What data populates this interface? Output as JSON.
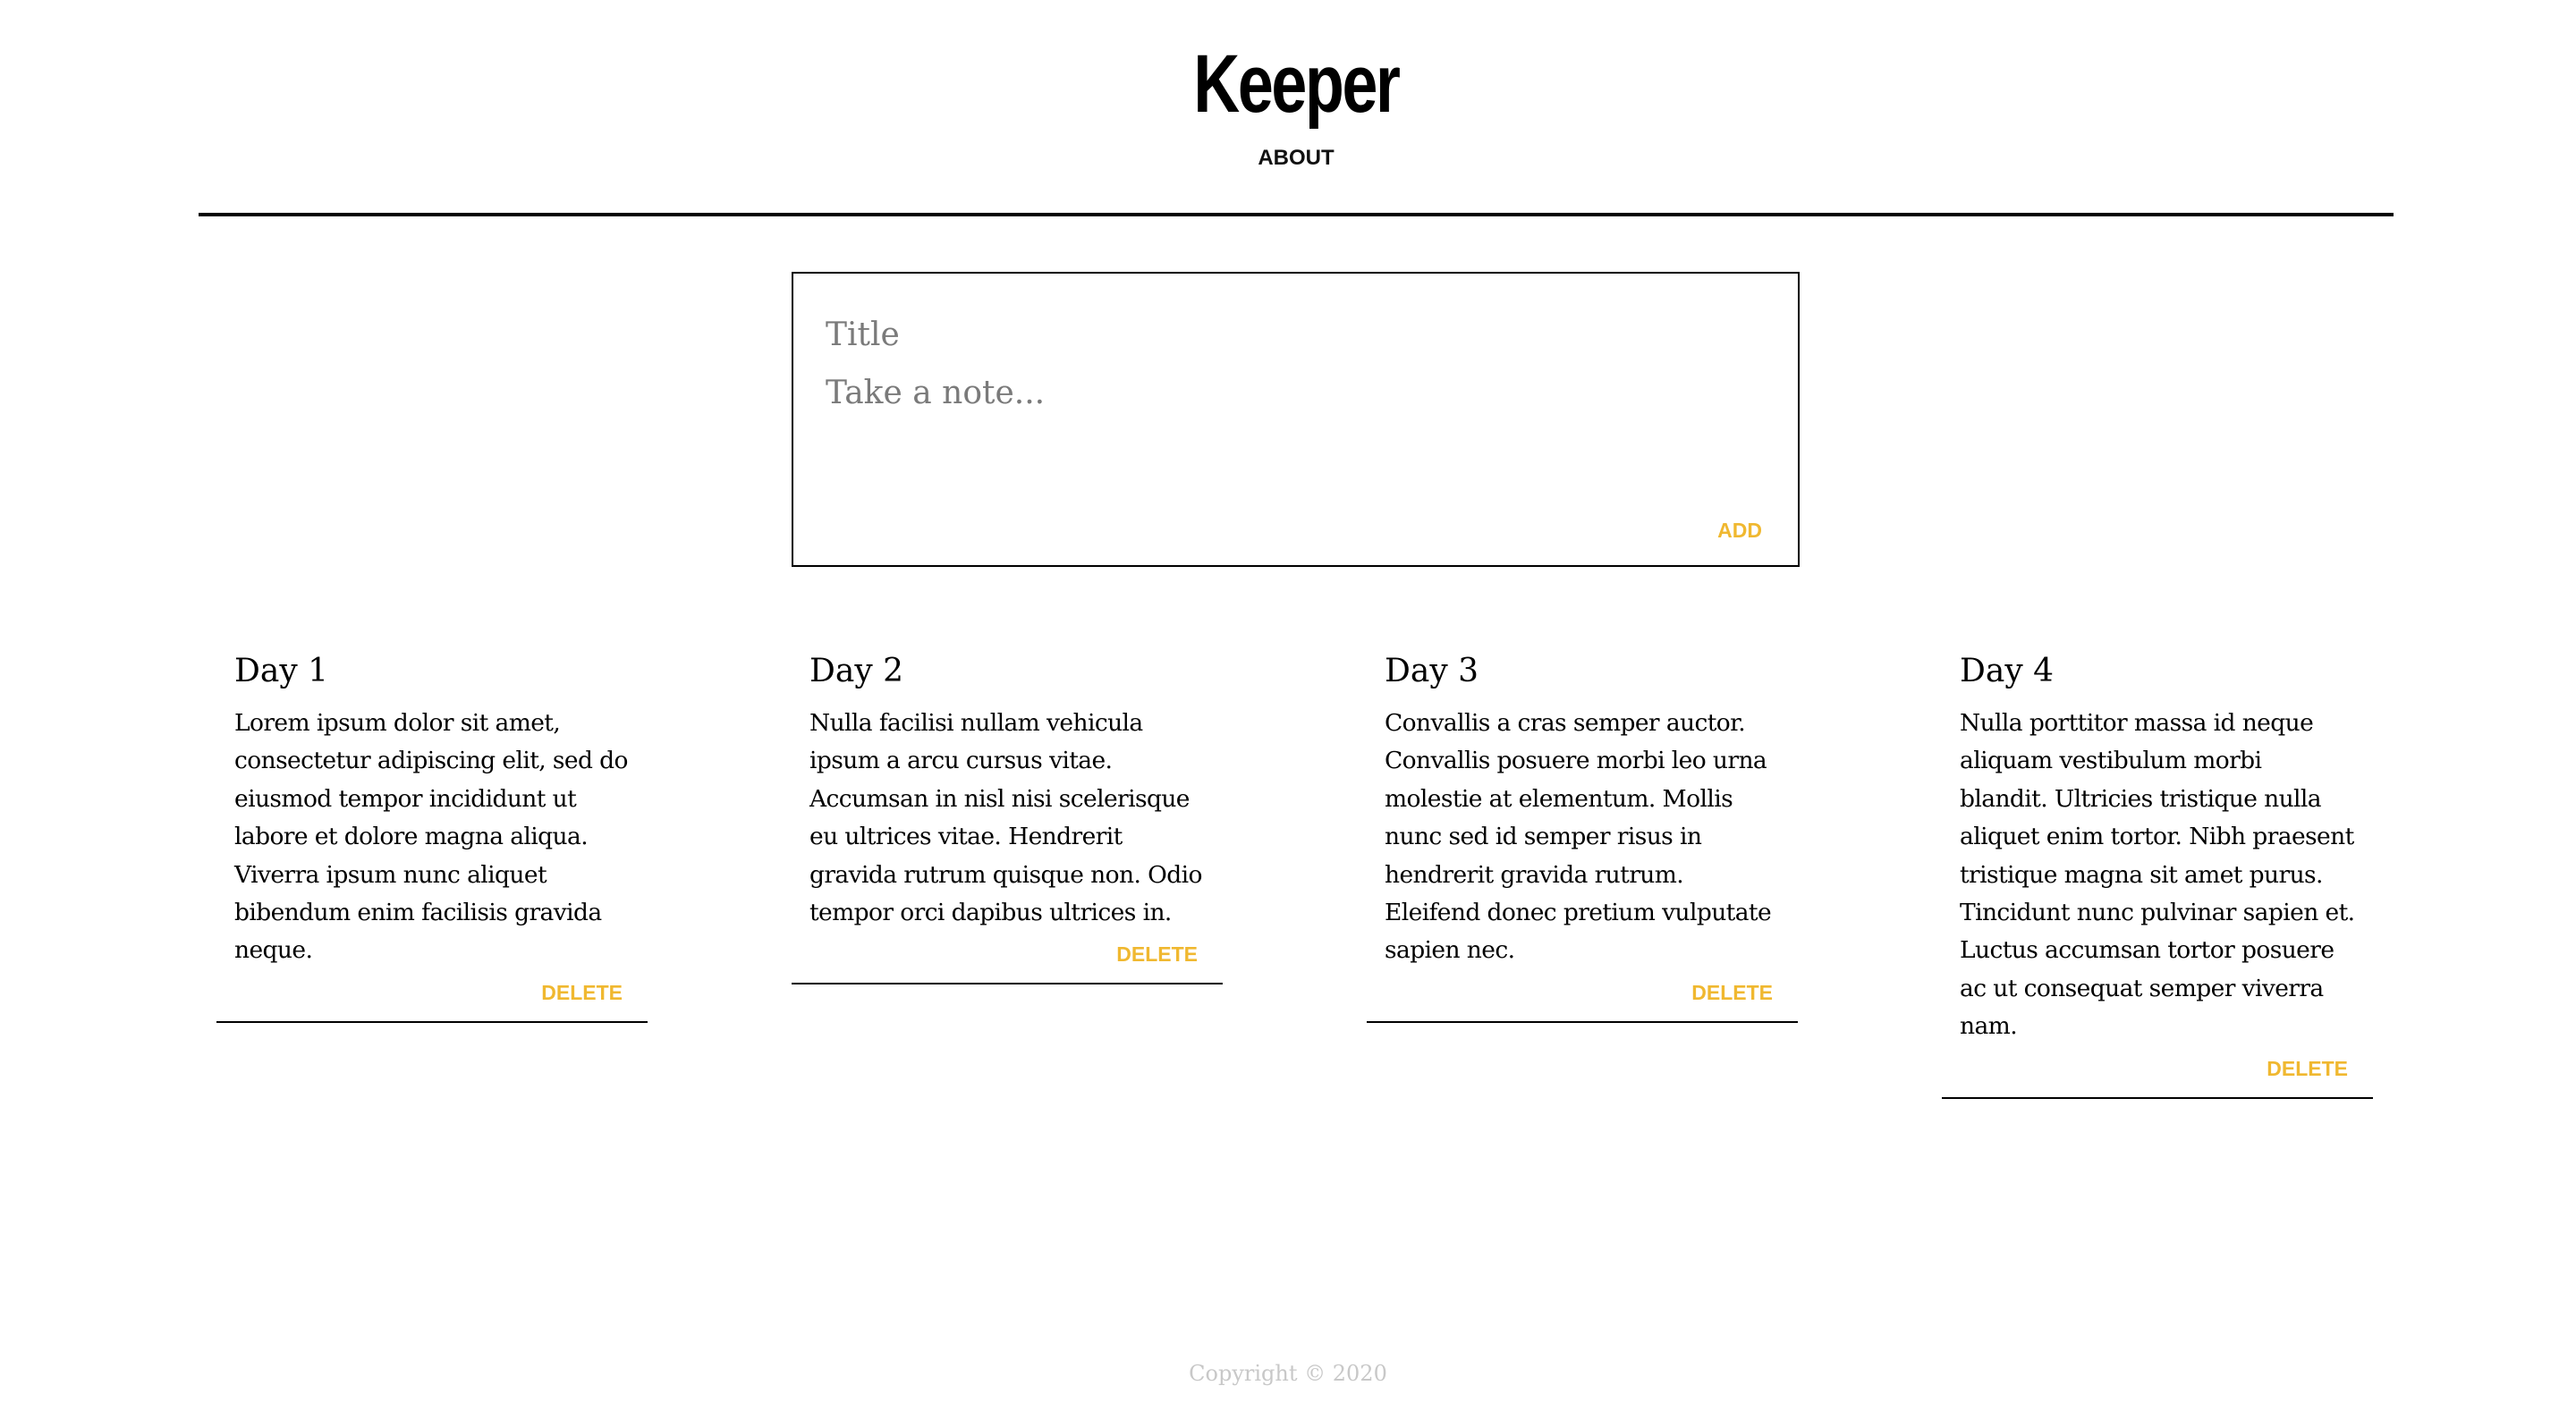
{
  "header": {
    "app_title": "Keeper",
    "nav_about": "ABOUT"
  },
  "create_form": {
    "title_placeholder": "Title",
    "content_placeholder": "Take a note...",
    "add_label": "ADD"
  },
  "notes": [
    {
      "title": "Day 1",
      "content": "Lorem ipsum dolor sit amet, consectetur adipiscing elit, sed do eiusmod tempor incididunt ut labore et dolore magna aliqua. Viverra ipsum nunc aliquet bibendum enim facilisis gravida neque.",
      "delete_label": "DELETE"
    },
    {
      "title": "Day 2",
      "content": "Nulla facilisi nullam vehicula ipsum a arcu cursus vitae. Accumsan in nisl nisi scelerisque eu ultrices vitae. Hendrerit gravida rutrum quisque non. Odio tempor orci dapibus ultrices in.",
      "delete_label": "DELETE"
    },
    {
      "title": "Day 3",
      "content": "Convallis a cras semper auctor. Convallis posuere morbi leo urna molestie at elementum. Mollis nunc sed id semper risus in hendrerit gravida rutrum. Eleifend donec pretium vulputate sapien nec.",
      "delete_label": "DELETE"
    },
    {
      "title": "Day 4",
      "content": "Nulla porttitor massa id neque aliquam vestibulum morbi blandit. Ultricies tristique nulla aliquet enim tortor. Nibh praesent tristique magna sit amet purus. Tincidunt nunc pulvinar sapien et. Luctus accumsan tortor posuere ac ut consequat semper viverra nam.",
      "delete_label": "DELETE"
    }
  ],
  "footer": {
    "copyright": "Copyright © 2020"
  },
  "colors": {
    "accent": "#f0b830",
    "text": "#000000",
    "footer_text": "#c8c8c8"
  }
}
